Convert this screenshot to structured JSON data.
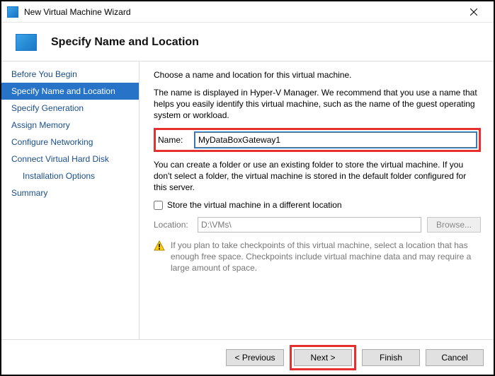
{
  "window": {
    "title": "New Virtual Machine Wizard"
  },
  "header": {
    "title": "Specify Name and Location"
  },
  "sidebar": {
    "items": [
      {
        "label": "Before You Begin",
        "active": false,
        "indent": false
      },
      {
        "label": "Specify Name and Location",
        "active": true,
        "indent": false
      },
      {
        "label": "Specify Generation",
        "active": false,
        "indent": false
      },
      {
        "label": "Assign Memory",
        "active": false,
        "indent": false
      },
      {
        "label": "Configure Networking",
        "active": false,
        "indent": false
      },
      {
        "label": "Connect Virtual Hard Disk",
        "active": false,
        "indent": false
      },
      {
        "label": "Installation Options",
        "active": false,
        "indent": true
      },
      {
        "label": "Summary",
        "active": false,
        "indent": false
      }
    ]
  },
  "content": {
    "intro": "Choose a name and location for this virtual machine.",
    "name_desc": "The name is displayed in Hyper-V Manager. We recommend that you use a name that helps you easily identify this virtual machine, such as the name of the guest operating system or workload.",
    "name_label": "Name:",
    "name_value": "MyDataBoxGateway1",
    "folder_desc": "You can create a folder or use an existing folder to store the virtual machine. If you don't select a folder, the virtual machine is stored in the default folder configured for this server.",
    "store_checkbox_label": "Store the virtual machine in a different location",
    "store_checked": false,
    "location_label": "Location:",
    "location_value": "D:\\VMs\\",
    "browse_label": "Browse...",
    "warning": "If you plan to take checkpoints of this virtual machine, select a location that has enough free space. Checkpoints include virtual machine data and may require a large amount of space."
  },
  "footer": {
    "previous": "< Previous",
    "next": "Next >",
    "finish": "Finish",
    "cancel": "Cancel"
  }
}
